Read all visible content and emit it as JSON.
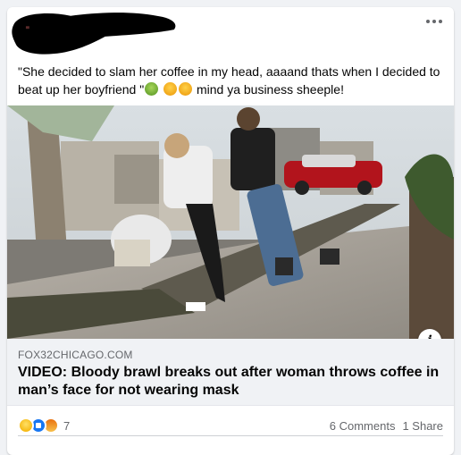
{
  "post": {
    "text": "\"She decided to slam her coffee in my head, aaaand thats when I decided to beat up her boyfriend \"",
    "text_suffix": "mind ya business sheeple!",
    "emojis": [
      "nauseated-face",
      "rolling-on-floor-laughing",
      "rolling-on-floor-laughing"
    ]
  },
  "link": {
    "domain": "FOX32CHICAGO.COM",
    "title": "VIDEO: Bloody brawl breaks out after woman throws coffee in man’s face for not wearing mask"
  },
  "reactions": {
    "types": [
      "haha",
      "like",
      "angry"
    ],
    "count": "7"
  },
  "stats": {
    "comments": "6 Comments",
    "shares": "1 Share"
  },
  "icons": {
    "more": "more-horizontal-icon",
    "info": "info-icon"
  },
  "colors": {
    "like_blue": "#1877f2",
    "secondary_text": "#65676b",
    "preview_bg": "#f0f2f5"
  }
}
